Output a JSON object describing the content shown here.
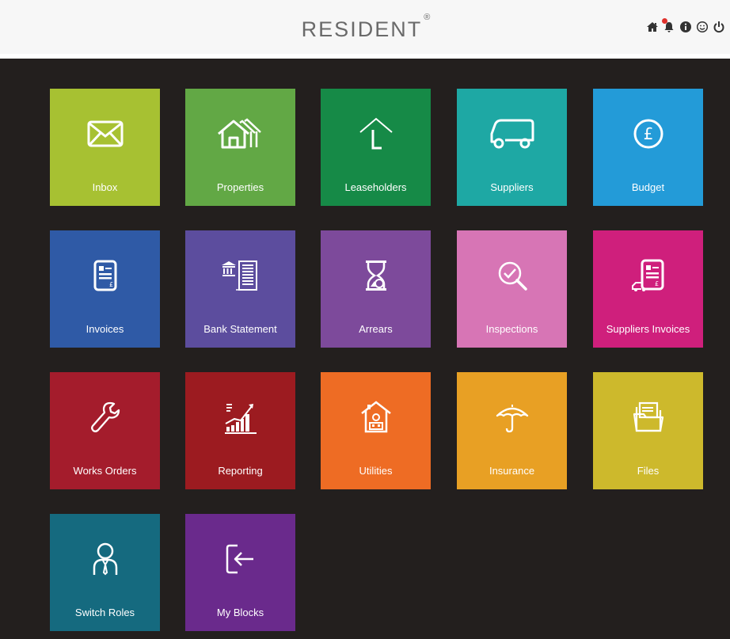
{
  "header": {
    "brand": "RESIDENT",
    "registered_mark": "®",
    "tools": [
      "home-icon",
      "bell-icon",
      "info-icon",
      "smiley-icon",
      "power-icon"
    ]
  },
  "tiles": [
    {
      "label": "Inbox",
      "color": "#a7c132",
      "icon": "envelope-icon"
    },
    {
      "label": "Properties",
      "color": "#62a845",
      "icon": "houses-icon"
    },
    {
      "label": "Leaseholders",
      "color": "#168a47",
      "icon": "roof-l-icon"
    },
    {
      "label": "Suppliers",
      "color": "#1ea8a4",
      "icon": "truck-icon"
    },
    {
      "label": "Budget",
      "color": "#239bd8",
      "icon": "pound-circle-icon"
    },
    {
      "label": "Invoices",
      "color": "#2f5aa6",
      "icon": "invoice-icon"
    },
    {
      "label": "Bank Statement",
      "color": "#5c4d9e",
      "icon": "bank-statement-icon"
    },
    {
      "label": "Arrears",
      "color": "#7d4a9b",
      "icon": "hourglass-icon"
    },
    {
      "label": "Inspections",
      "color": "#d775b5",
      "icon": "magnifier-check-icon"
    },
    {
      "label": "Suppliers Invoices",
      "color": "#cf1f7c",
      "icon": "truck-invoice-icon"
    },
    {
      "label": "Works Orders",
      "color": "#a41c2c",
      "icon": "wrench-icon"
    },
    {
      "label": "Reporting",
      "color": "#9c1b20",
      "icon": "growth-chart-icon"
    },
    {
      "label": "Utilities",
      "color": "#ee6c24",
      "icon": "house-utilities-icon"
    },
    {
      "label": "Insurance",
      "color": "#e8a024",
      "icon": "umbrella-icon"
    },
    {
      "label": "Files",
      "color": "#cdb92c",
      "icon": "folder-files-icon"
    },
    {
      "label": "Switch Roles",
      "color": "#156a7f",
      "icon": "user-icon"
    },
    {
      "label": "My Blocks",
      "color": "#6a2a8c",
      "icon": "exit-arrow-icon"
    }
  ]
}
